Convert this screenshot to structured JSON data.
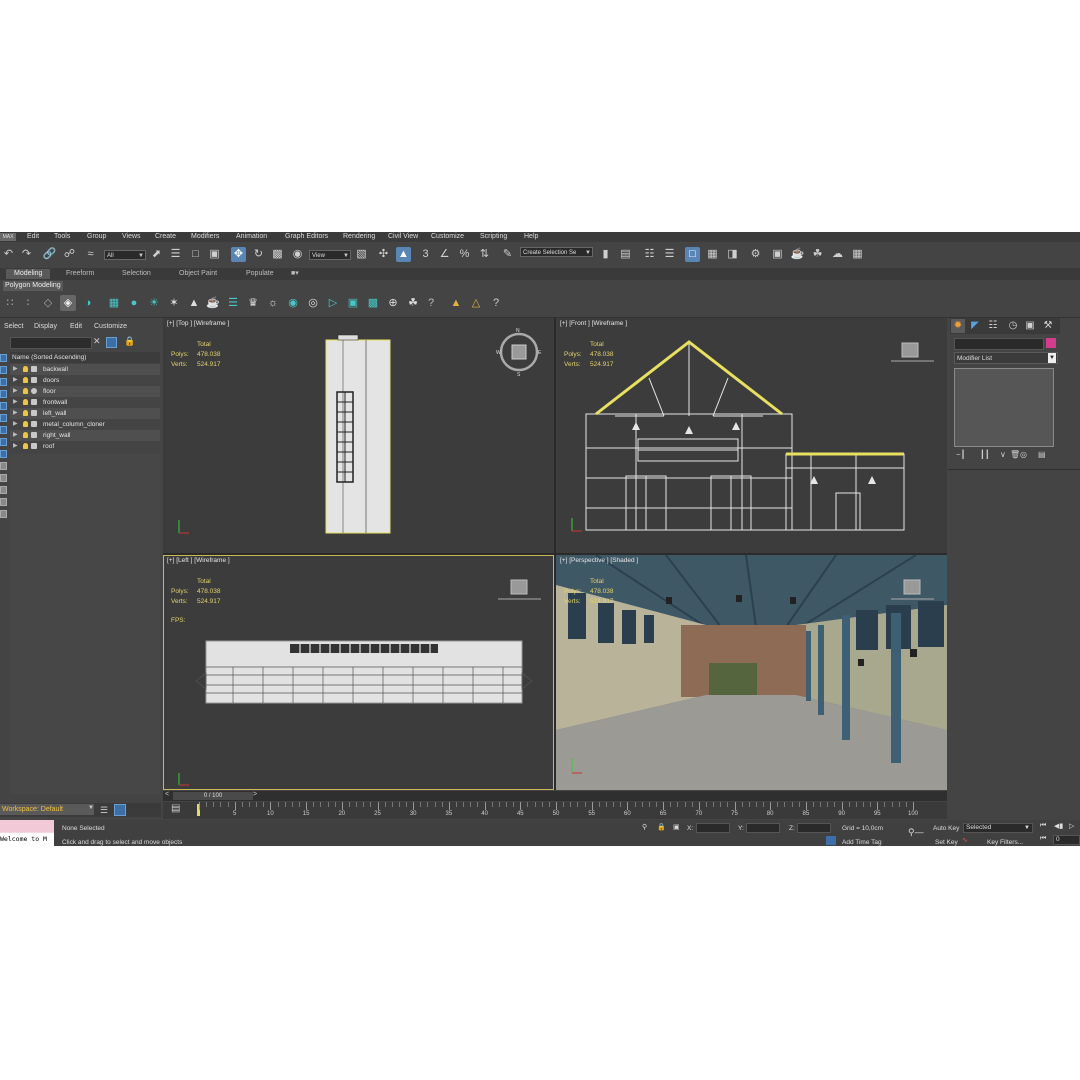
{
  "menu": {
    "logo": "MAX",
    "items": [
      "Edit",
      "Tools",
      "Group",
      "Views",
      "Create",
      "Modifiers",
      "Animation",
      "Graph Editors",
      "Rendering",
      "Civil View",
      "Customize",
      "Scripting",
      "Help"
    ]
  },
  "toolbar": {
    "selection_filter": "All",
    "ref_coord": "View",
    "named_selection": "Create Selection Se",
    "snap_label": "3"
  },
  "ribbon": {
    "tabs": [
      "Modeling",
      "Freeform",
      "Selection",
      "Object Paint",
      "Populate"
    ],
    "active_tab": "Modeling",
    "sub_label": "Polygon Modeling"
  },
  "scene_explorer": {
    "menu": [
      "Select",
      "Display",
      "Edit",
      "Customize"
    ],
    "column_header": "Name (Sorted Ascending)",
    "objects": [
      "backwall",
      "doors",
      "floor",
      "frontwall",
      "left_wall",
      "metal_column_cloner",
      "right_wall",
      "roof"
    ]
  },
  "viewports": {
    "top": {
      "label": "[+] [Top ] [Wireframe ]",
      "total": "Total",
      "polys_label": "Polys:",
      "polys": "478.038",
      "verts_label": "Verts:",
      "verts": "524.917"
    },
    "front": {
      "label": "[+] [Front ] [Wireframe ]",
      "total": "Total",
      "polys_label": "Polys:",
      "polys": "478.038",
      "verts_label": "Verts:",
      "verts": "524.917"
    },
    "left": {
      "label": "[+] [Left ] [Wireframe ]",
      "total": "Total",
      "polys_label": "Polys:",
      "polys": "478.038",
      "verts_label": "Verts:",
      "verts": "524.917",
      "fps_label": "FPS:"
    },
    "perspective": {
      "label": "[+] [Perspective ] [Shaded ]",
      "total": "Total",
      "polys_label": "Polys:",
      "polys": "478.038",
      "verts_label": "Verts:",
      "verts": "524.917"
    }
  },
  "command_panel": {
    "modifier_list": "Modifier List"
  },
  "timeline": {
    "slider": "0 / 100",
    "ticks": [
      "5",
      "10",
      "15",
      "20",
      "25",
      "30",
      "35",
      "40",
      "45",
      "50",
      "55",
      "60",
      "65",
      "70",
      "75",
      "80",
      "85",
      "90",
      "95",
      "100"
    ]
  },
  "workspace": {
    "label": "Workspace: Default"
  },
  "status": {
    "maxscript": "Welcome to M",
    "selection": "None Selected",
    "prompt": "Click and drag to select and move objects",
    "x_label": "X:",
    "y_label": "Y:",
    "z_label": "Z:",
    "grid": "Grid = 10,0cm",
    "add_time_tag": "Add Time Tag",
    "auto_key": "Auto Key",
    "selected": "Selected",
    "set_key": "Set Key",
    "key_filters": "Key Filters...",
    "frame": "0"
  },
  "colors": {
    "accent": "#5a86b5",
    "stats": "#e3d36a",
    "object_color": "#d53b8c",
    "workspace_text": "#f0c040"
  }
}
